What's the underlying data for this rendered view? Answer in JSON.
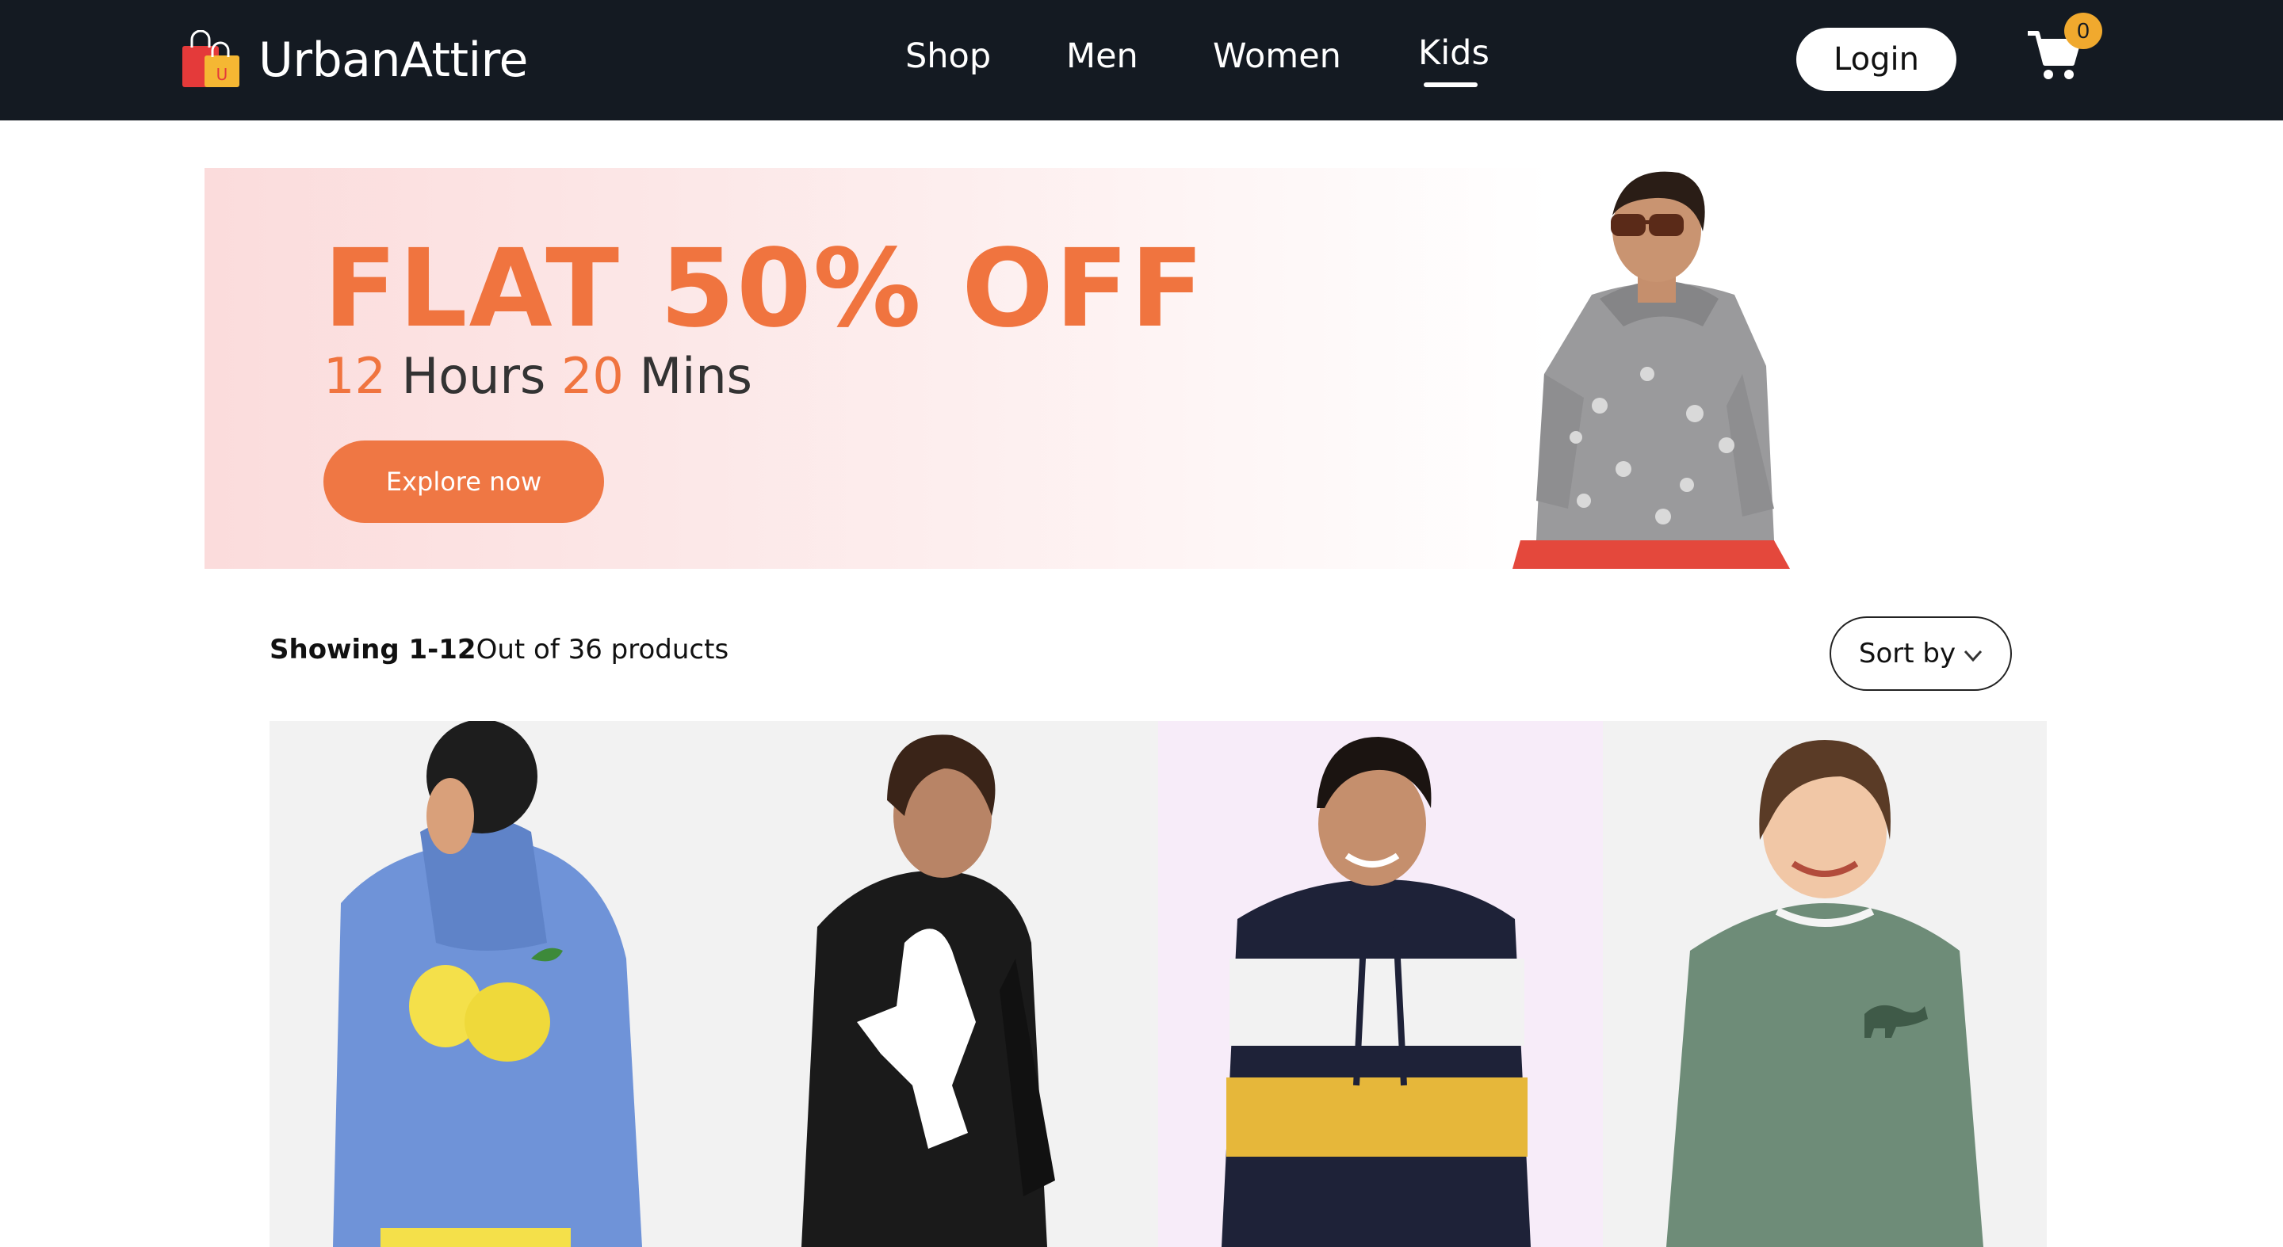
{
  "header": {
    "brand": "UrbanAttire",
    "logo_icon": "shopping-bag-icon",
    "nav": [
      {
        "label": "Shop",
        "active": false
      },
      {
        "label": "Men",
        "active": false
      },
      {
        "label": "Women",
        "active": false
      },
      {
        "label": "Kids",
        "active": true
      }
    ],
    "login_label": "Login",
    "cart_icon": "cart-icon",
    "cart_count": "0",
    "colors": {
      "background": "#141a22",
      "badge": "#f0a92e"
    }
  },
  "banner": {
    "title": "FLAT 50% OFF",
    "timer": {
      "hours": "12",
      "hours_label": "Hours",
      "mins": "20",
      "mins_label": "Mins"
    },
    "cta_label": "Explore now",
    "accent_color": "#f0743f"
  },
  "listing": {
    "showing_range": "Showing 1-12",
    "showing_total": "Out of 36 products",
    "sort_label": "Sort by",
    "sort_icon": "chevron-down-icon"
  },
  "products": [
    {
      "image": "blue-lemon-hoodie",
      "background": "#f2f2f2",
      "color": "#6f93d8"
    },
    {
      "image": "black-football-hoodie",
      "background": "#f2f2f2",
      "color": "#1a1a1a"
    },
    {
      "image": "striped-hoodie",
      "background": "#f7ecf9",
      "color": "#1e2238"
    },
    {
      "image": "green-dino-sweatshirt",
      "background": "#f2f2f2",
      "color": "#6e8c78"
    }
  ]
}
